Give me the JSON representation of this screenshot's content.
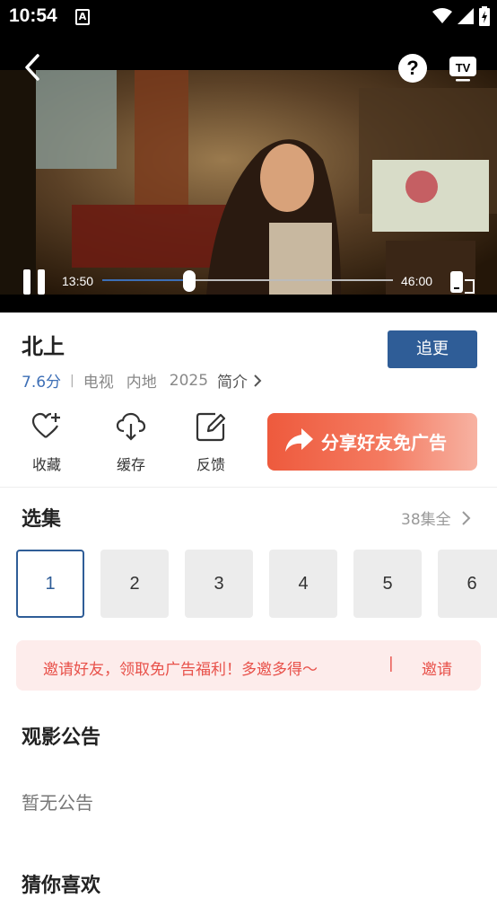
{
  "status_bar": {
    "time": "10:54",
    "notification_icon": "A",
    "icons": [
      "wifi-icon",
      "signal-icon",
      "battery-icon"
    ]
  },
  "player": {
    "current_time": "13:50",
    "duration": "46:00",
    "progress": 0.3,
    "icons": {
      "back": "back-icon",
      "help": "?",
      "cast": "TV"
    }
  },
  "show": {
    "title": "北上",
    "follow_label": "追更",
    "score": "7.6分",
    "separator": "|",
    "type": "电视",
    "region": "内地",
    "year": "2025",
    "intro_label": "简介"
  },
  "actions": [
    {
      "label": "收藏",
      "icon": "favorite-add-icon"
    },
    {
      "label": "缓存",
      "icon": "cloud-download-icon"
    },
    {
      "label": "反馈",
      "icon": "edit-feedback-icon"
    }
  ],
  "share_banner": {
    "label": "分享好友免广告"
  },
  "episodes": {
    "title": "选集",
    "count_label": "38集全",
    "items": [
      "1",
      "2",
      "3",
      "4",
      "5",
      "6"
    ],
    "selected": "1"
  },
  "invite": {
    "text": "邀请好友，领取免广告福利！多邀多得～",
    "separator": "|",
    "button": "邀请"
  },
  "notice": {
    "title": "观影公告",
    "body": "暂无公告"
  },
  "recommend": {
    "title": "猜你喜欢"
  },
  "colors": {
    "accent": "#2f5d97",
    "score": "#3d6fb6",
    "invite_text": "#e8514a",
    "invite_bg": "#fdeceb",
    "share_gradient_start": "#ee5a3d"
  }
}
